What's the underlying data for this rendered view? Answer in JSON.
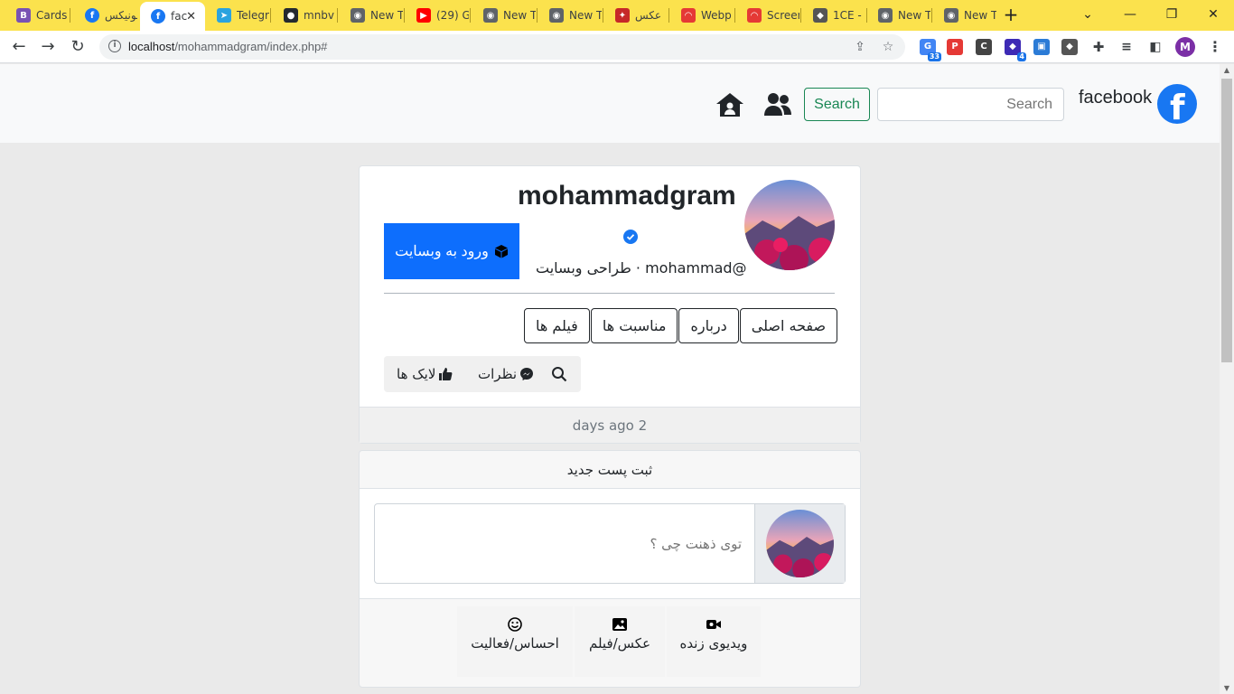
{
  "browser": {
    "tabs": [
      {
        "icon": "bootstrap-icon",
        "color": "#7952b3",
        "label": "Cards"
      },
      {
        "icon": "facebook-icon",
        "color": "#1877f2",
        "label": "فونیکس"
      },
      {
        "icon": "facebook-icon",
        "color": "#1877f2",
        "label": "fac",
        "active": true
      },
      {
        "icon": "telegram-icon",
        "color": "#2aa3df",
        "label": "Telegr"
      },
      {
        "icon": "github-icon",
        "color": "#24292f",
        "label": "mnbv"
      },
      {
        "icon": "chrome-icon",
        "color": "#5f6368",
        "label": "New T"
      },
      {
        "icon": "youtube-icon",
        "color": "#ff0000",
        "label": "(29) G"
      },
      {
        "icon": "chrome-icon",
        "color": "#5f6368",
        "label": "New T"
      },
      {
        "icon": "chrome-icon",
        "color": "#5f6368",
        "label": "New T"
      },
      {
        "icon": "tab-icon",
        "color": "#c62828",
        "label": "عکس"
      },
      {
        "icon": "rainbow-icon",
        "color": "#e53935",
        "label": "Webp"
      },
      {
        "icon": "rainbow-icon",
        "color": "#e53935",
        "label": "Screen"
      },
      {
        "icon": "cat-icon",
        "color": "#555555",
        "label": "1CE -"
      },
      {
        "icon": "chrome-icon",
        "color": "#5f6368",
        "label": "New T"
      },
      {
        "icon": "chrome-icon",
        "color": "#5f6368",
        "label": "New T"
      }
    ],
    "url_host": "localhost",
    "url_path": "/mohammadgram/index.php#",
    "extensions": [
      {
        "icon": "translate-extension-icon",
        "color": "#4285f4",
        "badge": "33"
      },
      {
        "icon": "p-extension-icon",
        "color": "#e53935",
        "badge": ""
      },
      {
        "icon": "c-extension-icon",
        "color": "#444444",
        "badge": ""
      },
      {
        "icon": "cube-extension-icon",
        "color": "#3d2ab5",
        "badge": "4"
      },
      {
        "icon": "monitor-extension-icon",
        "color": "#2b7bd6",
        "badge": ""
      },
      {
        "icon": "cat-extension-icon",
        "color": "#555555",
        "badge": ""
      }
    ],
    "profile_initial": "M"
  },
  "navbar": {
    "brand": "facebook",
    "search_placeholder": "Search",
    "search_button": "Search"
  },
  "profile": {
    "name": "mohammadgram",
    "subtitle": "طراحی وبسایت · mohammad@",
    "enter_button": "ورود به وبسایت",
    "tabs": [
      "صفحه اصلی",
      "درباره",
      "مناسبت ها",
      "فیلم ها"
    ],
    "actions": {
      "comments": "نظرات",
      "likes": "لایک ها"
    },
    "footer": "days ago 2"
  },
  "post": {
    "header": "ثبت پست جدید",
    "placeholder": "توی ذهنت چی ؟",
    "live_video": "ویدیوی زنده",
    "photo_video": "عکس/فیلم",
    "feeling": "احساس/فعالیت"
  }
}
